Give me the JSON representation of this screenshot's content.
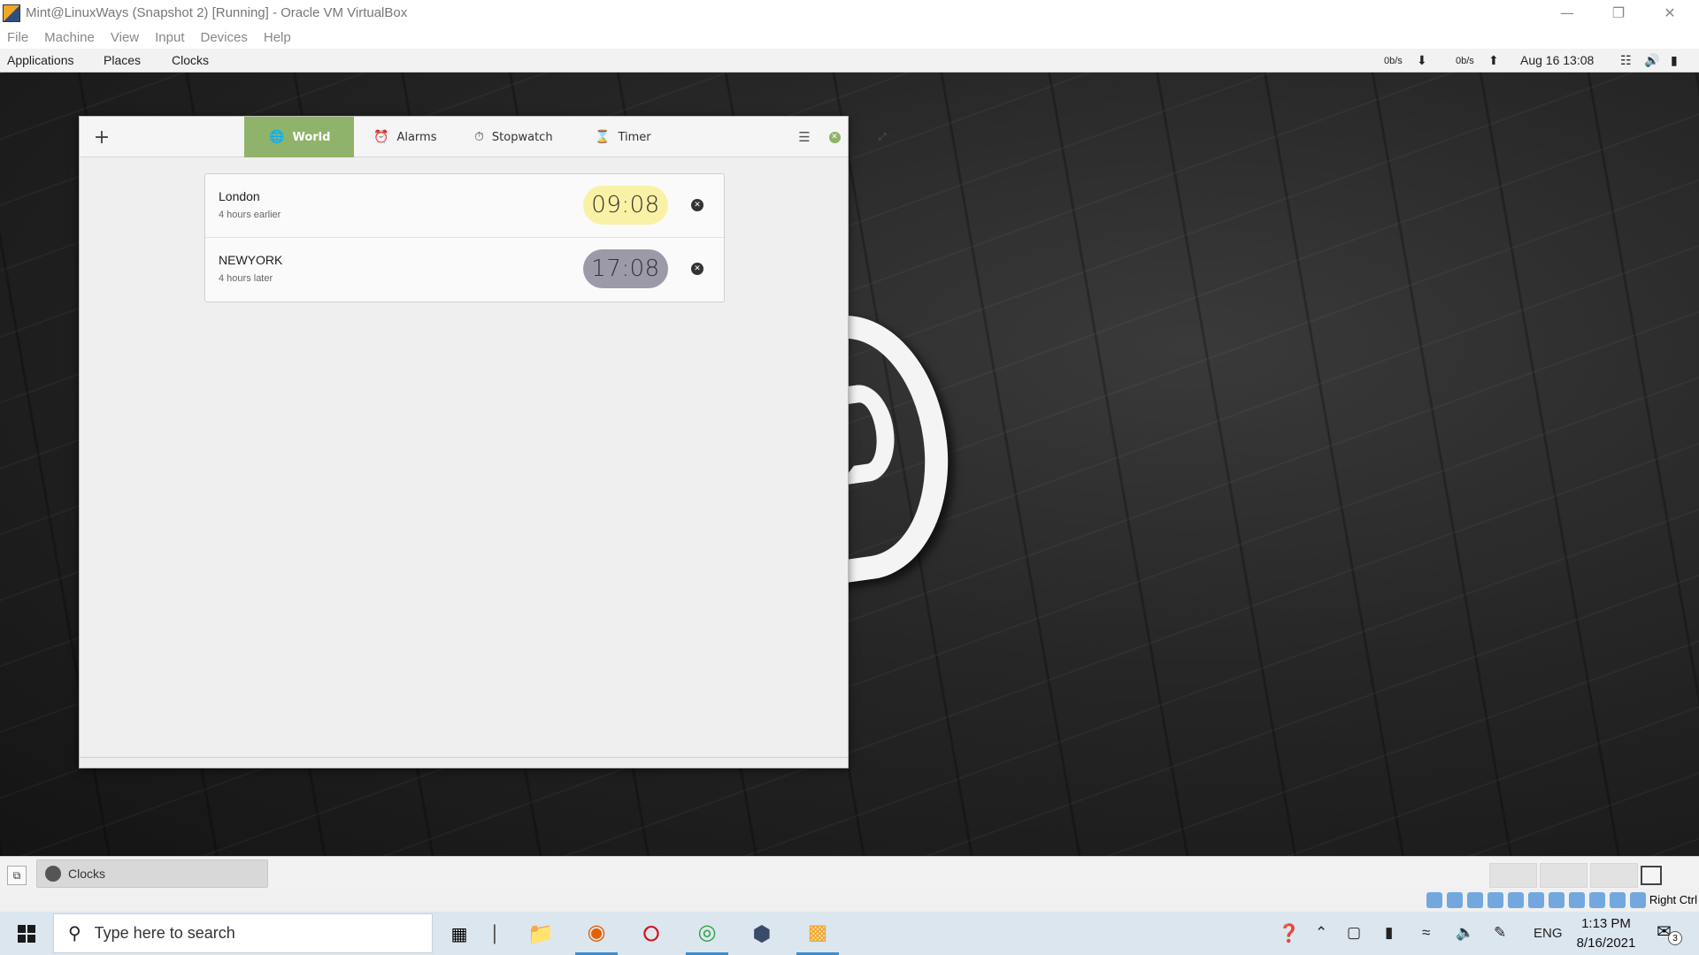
{
  "vbox": {
    "title": "Mint@LinuxWays (Snapshot 2) [Running] - Oracle VM VirtualBox",
    "menu": [
      "File",
      "Machine",
      "View",
      "Input",
      "Devices",
      "Help"
    ],
    "host_key": "Right Ctrl"
  },
  "top_panel": {
    "menus": [
      "Applications",
      "Places",
      "Clocks"
    ],
    "net_down": "0b/s",
    "net_up": "0b/s",
    "datetime": "Aug 16  13:08"
  },
  "clocks_app": {
    "add_label": "+",
    "tabs": [
      {
        "label": "World",
        "icon": "globe-icon",
        "active": true
      },
      {
        "label": "Alarms",
        "icon": "alarm-clock-icon",
        "active": false
      },
      {
        "label": "Stopwatch",
        "icon": "stopwatch-icon",
        "active": false
      },
      {
        "label": "Timer",
        "icon": "hourglass-icon",
        "active": false
      }
    ],
    "world_clocks": [
      {
        "city": "London",
        "offset": "4 hours earlier",
        "time": "09:08",
        "daytime": true
      },
      {
        "city": "NEWYORK",
        "offset": "4 hours later",
        "time": "17:08",
        "daytime": false
      }
    ],
    "colors": {
      "accent": "#8fb36a",
      "day_pill": "#f9f1a5",
      "night_pill": "#9c9aa8"
    }
  },
  "bottom_panel": {
    "task_label": "Clocks"
  },
  "win_taskbar": {
    "search_placeholder": "Type here to search",
    "language": "ENG",
    "time": "1:13 PM",
    "date": "8/16/2021",
    "notification_count": "3"
  }
}
